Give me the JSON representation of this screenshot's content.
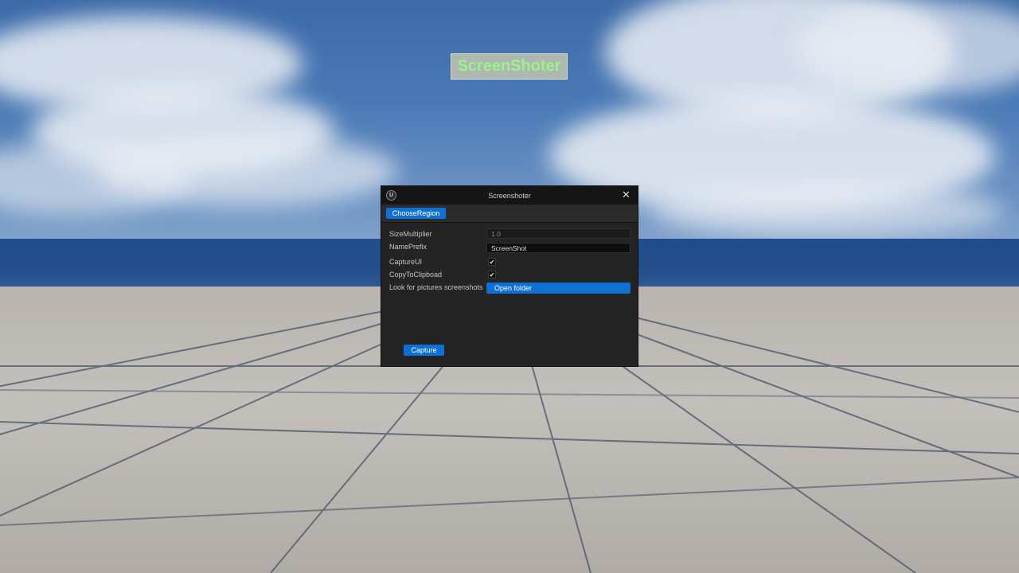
{
  "hud": {
    "title": "ScreenShoter"
  },
  "window": {
    "title": "Screenshoter",
    "logo_text": "U",
    "close_glyph": "✕"
  },
  "toolbar": {
    "choose_region_label": "ChooseRegion"
  },
  "form": {
    "size_multiplier": {
      "label": "SizeMultiplier",
      "value": "1.0"
    },
    "name_prefix": {
      "label": "NamePrefix",
      "value": "ScreenShot"
    },
    "capture_ui": {
      "label": "CaptureUI",
      "checked": true,
      "glyph": "✔"
    },
    "copy_to_clipboard": {
      "label": "CopyToClipboad",
      "checked": true,
      "glyph": "✔"
    },
    "screenshots_folder": {
      "label": "Look for pictures screenshots",
      "button_label": "Open folder"
    }
  },
  "footer": {
    "capture_label": "Capture"
  },
  "colors": {
    "accent": "#0e70d4",
    "panel": "#242424",
    "titlebar": "#151515",
    "hud_text": "#9ef08a"
  }
}
